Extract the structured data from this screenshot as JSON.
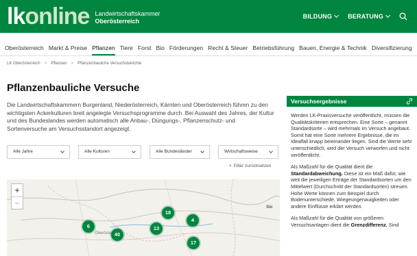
{
  "header": {
    "logo_lk": "lk",
    "logo_online": "online",
    "org_line1": "Landwirtschaftskammer",
    "org_line2": "Oberösterreich",
    "nav": [
      {
        "label": "BILDUNG"
      },
      {
        "label": "BERATUNG"
      }
    ]
  },
  "categories": [
    {
      "label": "Oberösterreich",
      "active": false
    },
    {
      "label": "Markt & Preise",
      "active": false
    },
    {
      "label": "Pflanzen",
      "active": true
    },
    {
      "label": "Tiere",
      "active": false
    },
    {
      "label": "Forst",
      "active": false
    },
    {
      "label": "Bio",
      "active": false
    },
    {
      "label": "Förderungen",
      "active": false
    },
    {
      "label": "Recht & Steuer",
      "active": false
    },
    {
      "label": "Betriebsführung",
      "active": false
    },
    {
      "label": "Bauen, Energie & Technik",
      "active": false
    },
    {
      "label": "Diversifizierung",
      "active": false
    }
  ],
  "breadcrumb": [
    "LK Oberösterreich",
    "Pflanzen",
    "Pflanzenbauliche Versuchsberichte"
  ],
  "page": {
    "title": "Pflanzenbauliche Versuche",
    "intro": "Die Landwirtschaftskammern Burgenland, Niederösterreich, Kärnten und Oberösterreich führen zu den wichtigsten Ackerkulturen breit angelegte Versuchsprogramme durch. Bei Auswahl des Jahres, der Kultur und des Bundeslandes werden automatisch alle Anbau-, Düngungs-, Pflanzenschutz- und Sortenversuche am Versuchsstandort angezeigt."
  },
  "filters": {
    "year": "Alle Jahre",
    "crop": "Alle Kulturen",
    "state": "Alle Bundesländer",
    "region": "Wirtschaftsweise",
    "reset": "Filter zurücksetzen"
  },
  "map": {
    "zoom_in": "+",
    "zoom_out": "−",
    "labels": [
      "Oberöste",
      "Slo"
    ],
    "clusters": [
      {
        "count": "6"
      },
      {
        "count": "40"
      },
      {
        "count": "18"
      },
      {
        "count": "13"
      },
      {
        "count": "4"
      },
      {
        "count": "17"
      }
    ]
  },
  "sidebar": {
    "title": "Versuchsergebnisse",
    "p1": "Werden LK-Praxisversuche veröffentlicht, müssen die Qualitätskriterien entsprechen. Eine Sorte – genannt Standardsorte – wird mehrmals im Versuch angebaut. Somit hat eine Sorte mehrere Ergebnisse, die im Idealfall knapp beieinander liegen. Sind die Werte sehr unterschiedlich, wird der Versuch verworfen und nicht veröffentlicht.",
    "p2_a": "Als Maßzahl für die Qualität dient die ",
    "p2_b": "Standardabweichung.",
    "p2_c": " Diese ist ein Maß dafür, wie weit die jeweiligen Erträge der Standardsorten um den Mittelwert (Durchschnitt der Standardsorten) streuen. Hohe Werte können zum Beispiel durch Bodenunterschiede, Wiegeungenauigkeiten oder andere Einflüsse erklärt werden.",
    "p3_a": "Als Maßzahl für die Qualität von größeren Versuchsanlagen dient die ",
    "p3_b": "Grenzdifferenz.",
    "p3_c": " Sind"
  },
  "colors": {
    "brand_green": "#00853f"
  }
}
